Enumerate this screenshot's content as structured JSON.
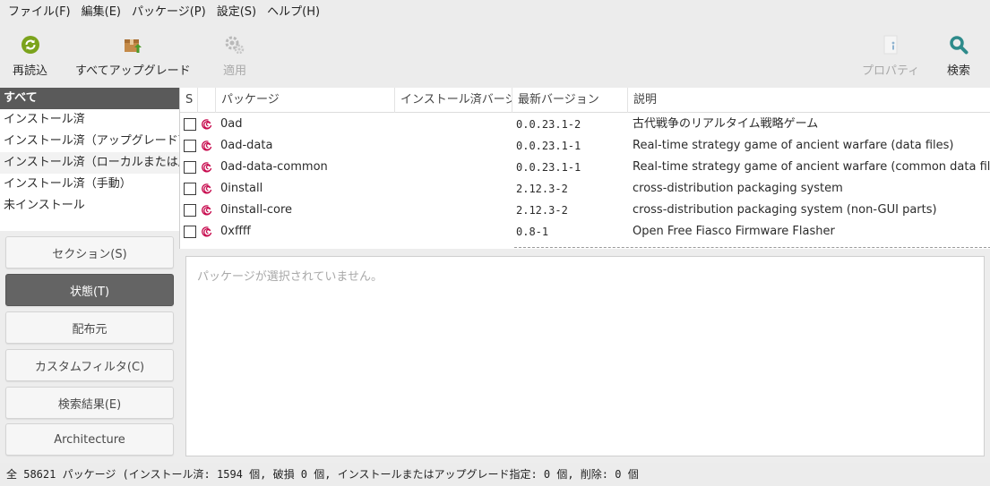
{
  "menubar": {
    "items": [
      "ファイル(F)",
      "編集(E)",
      "パッケージ(P)",
      "設定(S)",
      "ヘルプ(H)"
    ]
  },
  "toolbar": {
    "reload": "再読込",
    "upgrade_all": "すべてアップグレード",
    "apply": "適用",
    "properties": "プロパティ",
    "search": "検索"
  },
  "status_filters": {
    "items": [
      "すべて",
      "インストール済",
      "インストール済（アップグレード可能）",
      "インストール済（ローカルまたは廃止）",
      "インストール済（手動）",
      "未インストール"
    ],
    "selected_index": 0
  },
  "filter_buttons": {
    "section": "セクション(S)",
    "status": "状態(T)",
    "origin": "配布元",
    "custom": "カスタムフィルタ(C)",
    "search_results": "検索結果(E)",
    "architecture": "Architecture",
    "active": "status"
  },
  "table": {
    "columns": {
      "s": "S",
      "package": "パッケージ",
      "installed_version": "インストール済バージョン",
      "latest_version": "最新バージョン",
      "description": "説明"
    },
    "rows": [
      {
        "package": "0ad",
        "installed": "",
        "latest": "0.0.23.1-2",
        "description": "古代戦争のリアルタイム戦略ゲーム"
      },
      {
        "package": "0ad-data",
        "installed": "",
        "latest": "0.0.23.1-1",
        "description": "Real-time strategy game of ancient warfare (data files)"
      },
      {
        "package": "0ad-data-common",
        "installed": "",
        "latest": "0.0.23.1-1",
        "description": "Real-time strategy game of ancient warfare (common data files)"
      },
      {
        "package": "0install",
        "installed": "",
        "latest": "2.12.3-2",
        "description": "cross-distribution packaging system"
      },
      {
        "package": "0install-core",
        "installed": "",
        "latest": "2.12.3-2",
        "description": "cross-distribution packaging system (non-GUI parts)"
      },
      {
        "package": "0xffff",
        "installed": "",
        "latest": "0.8-1",
        "description": "Open Free Fiasco Firmware Flasher"
      }
    ]
  },
  "detail": {
    "placeholder": "パッケージが選択されていません。"
  },
  "statusbar": {
    "text": "全 58621 パッケージ (インストール済: 1594 個, 破損 0 個, インストールまたはアップグレード指定: 0 個, 削除: 0 個"
  },
  "colors": {
    "reload_icon": "#7ba31c",
    "search_icon": "#2e8b8b",
    "debian_swirl": "#c70a4d",
    "selected_row": "#5a5a5a"
  }
}
